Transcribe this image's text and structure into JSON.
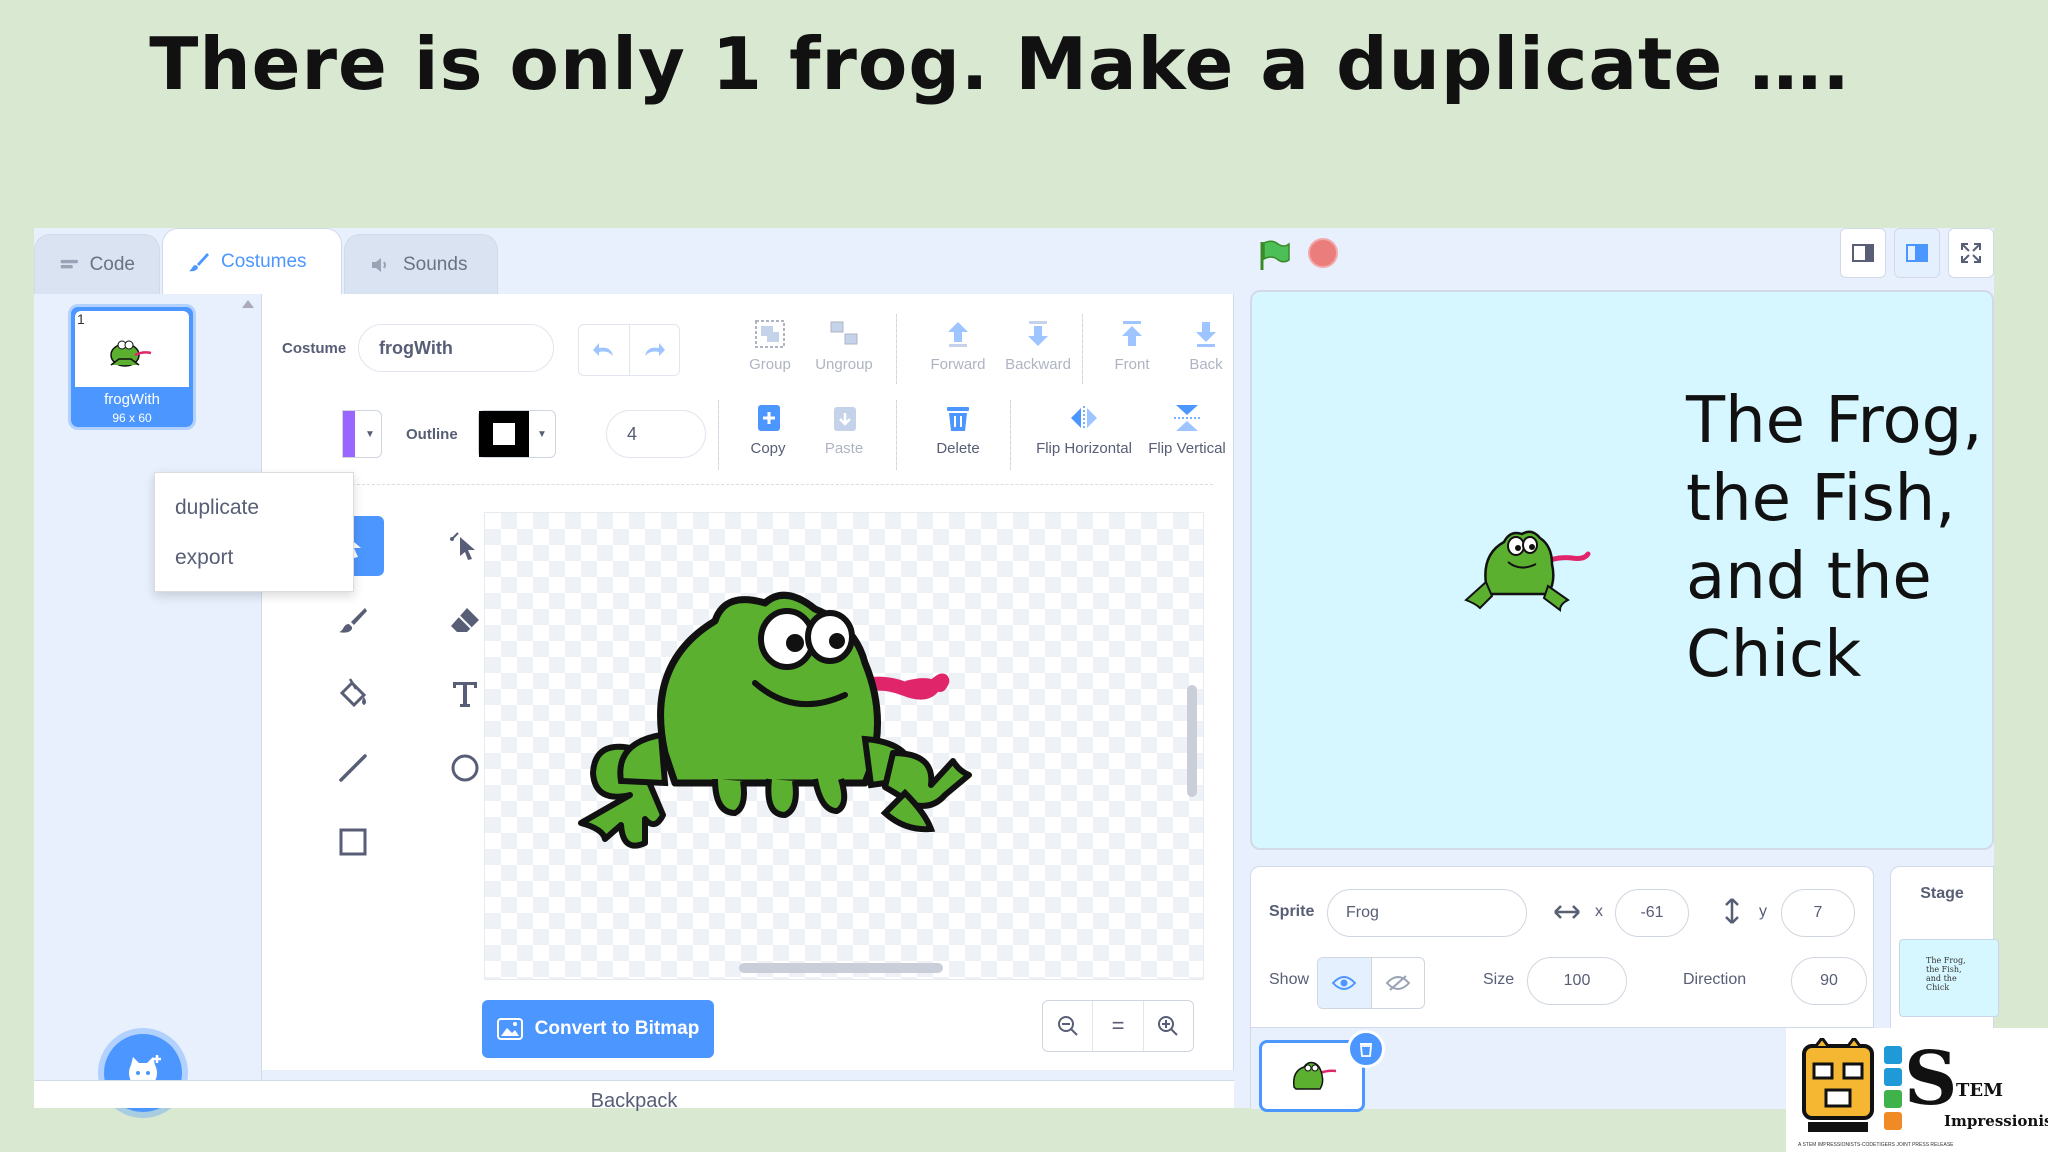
{
  "slide": {
    "title": "There is only 1 frog. Make a duplicate …."
  },
  "tabs": [
    {
      "label": "Code",
      "icon": "code-icon",
      "state": "inactive"
    },
    {
      "label": "Costumes",
      "icon": "brush-icon",
      "state": "active"
    },
    {
      "label": "Sounds",
      "icon": "speaker-icon",
      "state": "inactive"
    }
  ],
  "costume_list": {
    "items": [
      {
        "number": "1",
        "name": "frogWith",
        "size": "96 x 60"
      }
    ],
    "context_menu": [
      "duplicate",
      "export"
    ]
  },
  "editor": {
    "costume_label": "Costume",
    "costume_name": "frogWith",
    "outline_label": "Outline",
    "outline_width": "4",
    "toolbar": {
      "group": "Group",
      "ungroup": "Ungroup",
      "forward": "Forward",
      "backward": "Backward",
      "front": "Front",
      "back": "Back",
      "copy": "Copy",
      "paste": "Paste",
      "delete": "Delete",
      "flip_horizontal": "Flip Horizontal",
      "flip_vertical": "Flip Vertical"
    },
    "convert_button": "Convert to Bitmap",
    "zoom_reset": "="
  },
  "backpack": "Backpack",
  "stage": {
    "title_text": "The Frog,\nthe Fish,\nand the\nChick"
  },
  "sprite_info": {
    "sprite_label": "Sprite",
    "sprite_name": "Frog",
    "x_label": "x",
    "x": "-61",
    "y_label": "y",
    "y": "7",
    "show_label": "Show",
    "size_label": "Size",
    "size": "100",
    "direction_label": "Direction",
    "direction": "90"
  },
  "stage_pane": {
    "label": "Stage",
    "thumb_text": "The Frog,\nthe Fish,\nand the\nChick"
  },
  "logo": {
    "s_letter": "S",
    "top_text": "TEM",
    "bottom_text": "Impressionists",
    "tagline": "A STEM IMPRESSIONISTS-CODETIGERS JOINT PRESS RELEASE"
  },
  "colors": {
    "scratch_blue": "#4c97ff",
    "fill_purple": "#9966ff",
    "frog_green": "#5cb030",
    "tongue": "#e0256b",
    "stage_bg": "#d6f7ff"
  }
}
